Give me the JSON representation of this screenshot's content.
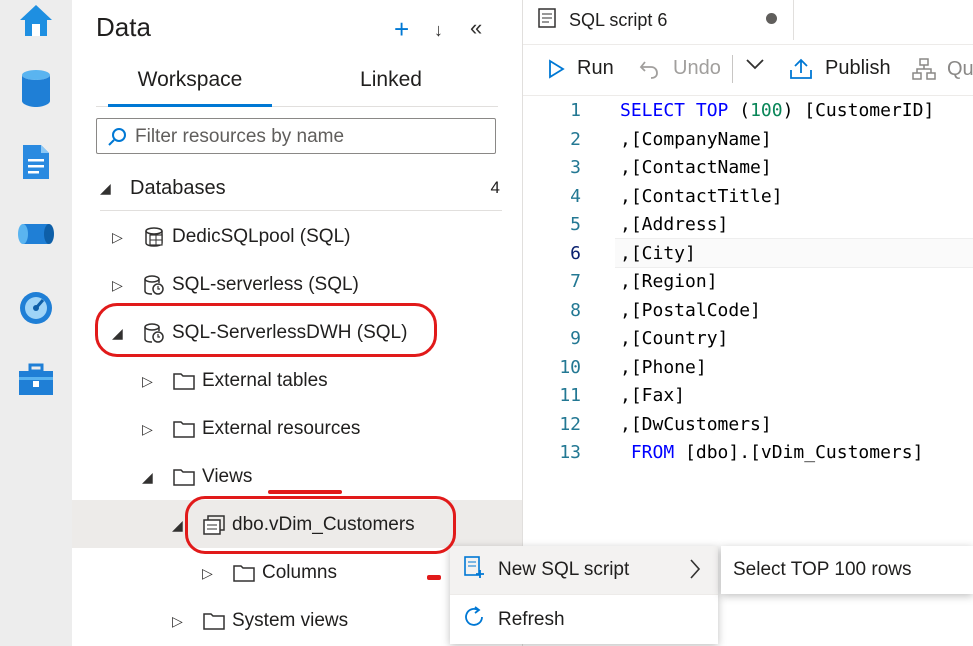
{
  "rail": {
    "icons": [
      "home-icon",
      "data-icon",
      "develop-icon",
      "integrate-icon",
      "monitor-icon",
      "manage-icon"
    ]
  },
  "panel": {
    "title": "Data",
    "tabs": [
      "Workspace",
      "Linked"
    ],
    "search_placeholder": "Filter resources by name",
    "section_label": "Databases",
    "section_count": "4",
    "tree": {
      "dedic": "DedicSQLpool (SQL)",
      "serverless": "SQL-serverless (SQL)",
      "serverless_dwh": "SQL-ServerlessDWH (SQL)",
      "external_tables": "External tables",
      "external_resources": "External resources",
      "views": "Views",
      "view_item": "dbo.vDim_Customers",
      "columns": "Columns",
      "system_views": "System views"
    }
  },
  "editor": {
    "tab_title": "SQL script 6",
    "toolbar": {
      "run": "Run",
      "undo": "Undo",
      "publish": "Publish",
      "query_partial": "Qu"
    },
    "lines": [
      {
        "num": "1",
        "kw": "SELECT TOP ",
        "num_val": "100",
        "rest": " [CustomerID]"
      },
      {
        "num": "2",
        "text": ",[CompanyName]"
      },
      {
        "num": "3",
        "text": ",[ContactName]"
      },
      {
        "num": "4",
        "text": ",[ContactTitle]"
      },
      {
        "num": "5",
        "text": ",[Address]"
      },
      {
        "num": "6",
        "text": ",[City]"
      },
      {
        "num": "7",
        "text": ",[Region]"
      },
      {
        "num": "8",
        "text": ",[PostalCode]"
      },
      {
        "num": "9",
        "text": ",[Country]"
      },
      {
        "num": "10",
        "text": ",[Phone]"
      },
      {
        "num": "11",
        "text": ",[Fax]"
      },
      {
        "num": "12",
        "text": ",[DwCustomers]"
      },
      {
        "num": "13",
        "kw": " FROM",
        "rest": " [dbo].[vDim_Customers]"
      }
    ]
  },
  "context_menu": {
    "new_sql_script": "New SQL script",
    "refresh": "Refresh"
  },
  "submenu": {
    "select_top": "Select TOP 100 rows"
  },
  "colors": {
    "accent": "#0078d4",
    "annotation": "#e11a1a"
  }
}
